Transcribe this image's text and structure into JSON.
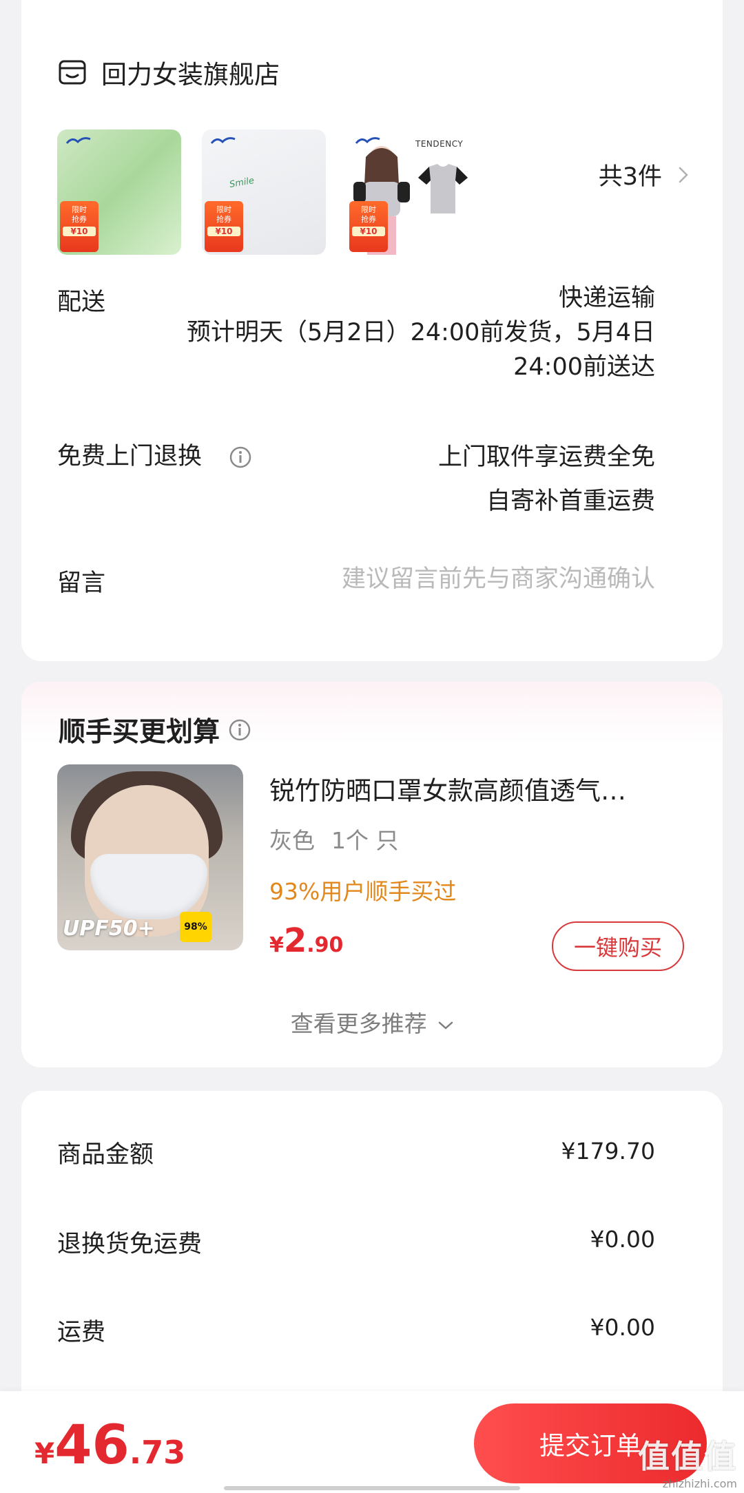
{
  "store": {
    "name": "回力女装旗舰店",
    "icon": "store-icon"
  },
  "items": {
    "count_label": "共3件",
    "thumb_tags": [
      {
        "top": "限时",
        "mid": "抢券",
        "price": "¥10"
      },
      {
        "top": "限时",
        "mid": "抢券",
        "price": "¥10"
      },
      {
        "top": "限时",
        "mid": "抢券",
        "price": "¥10"
      }
    ],
    "thumb2_text": "Smile",
    "thumb3_brand": "TENDENCY"
  },
  "delivery": {
    "label": "配送",
    "method": "快递运输",
    "eta_line1": "预计明天（5月2日）24:00前发货，5月4日",
    "eta_line2": "24:00前送达"
  },
  "returns": {
    "label": "免费上门退换",
    "line1": "上门取件享运费全免",
    "line2": "自寄补首重运费"
  },
  "note": {
    "label": "留言",
    "placeholder": "建议留言前先与商家沟通确认"
  },
  "recommend": {
    "title": "顺手买更划算",
    "product": {
      "name": "锐竹防晒口罩女款高颜值透气…",
      "color": "灰色",
      "qty": "1个 只",
      "social": "93%用户顺手买过",
      "price_symbol": "¥",
      "price_int": "2",
      "price_dec": ".90",
      "img_text": "UPF50+",
      "uv_badge": "98%"
    },
    "buy_label": "一键购买",
    "more_label": "查看更多推荐"
  },
  "summary": {
    "rows": [
      {
        "label": "商品金额",
        "value": "¥179.70"
      },
      {
        "label": "退换货免运费",
        "value": "¥0.00"
      },
      {
        "label": "运费",
        "value": "¥0.00"
      }
    ]
  },
  "checkout": {
    "total_symbol": "¥",
    "total_int": "46",
    "total_dec": ".73",
    "submit_label": "提交订单"
  },
  "watermark": {
    "logo": "值值值",
    "url": "zhizhizhi.com"
  },
  "colors": {
    "accent": "#e3292f",
    "social": "#e2871b",
    "placeholder": "#b9b9b9"
  }
}
